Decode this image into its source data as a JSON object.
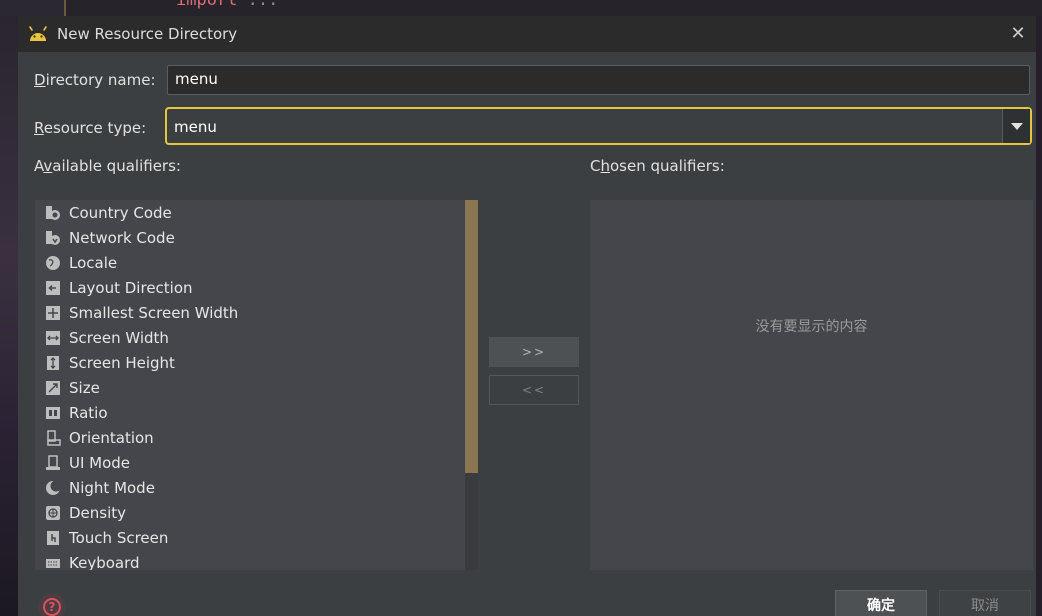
{
  "background": {
    "code_snippet": "import",
    "code_dots": "..."
  },
  "dialog": {
    "title": "New Resource Directory",
    "close_symbol": "✕",
    "directory_name": {
      "label_prefix": "",
      "label_mnemonic": "D",
      "label_rest": "irectory name:",
      "value": "menu"
    },
    "resource_type": {
      "label_mnemonic": "R",
      "label_rest": "esource type:",
      "value": "menu"
    },
    "available_qualifiers": {
      "label_prefix": "A",
      "label_mnemonic": "v",
      "label_rest": "ailable qualifiers:",
      "items": [
        {
          "label": "Country Code",
          "icon": "country-code-icon"
        },
        {
          "label": "Network Code",
          "icon": "network-code-icon"
        },
        {
          "label": "Locale",
          "icon": "globe-icon"
        },
        {
          "label": "Layout Direction",
          "icon": "layout-direction-icon"
        },
        {
          "label": "Smallest Screen Width",
          "icon": "smallest-width-icon"
        },
        {
          "label": "Screen Width",
          "icon": "screen-width-icon"
        },
        {
          "label": "Screen Height",
          "icon": "screen-height-icon"
        },
        {
          "label": "Size",
          "icon": "size-icon"
        },
        {
          "label": "Ratio",
          "icon": "ratio-icon"
        },
        {
          "label": "Orientation",
          "icon": "orientation-icon"
        },
        {
          "label": "UI Mode",
          "icon": "ui-mode-icon"
        },
        {
          "label": "Night Mode",
          "icon": "night-mode-icon"
        },
        {
          "label": "Density",
          "icon": "density-icon"
        },
        {
          "label": "Touch Screen",
          "icon": "touch-screen-icon"
        },
        {
          "label": "Keyboard",
          "icon": "keyboard-icon"
        }
      ]
    },
    "chosen_qualifiers": {
      "label_prefix": "C",
      "label_mnemonic": "h",
      "label_rest": "osen qualifiers:",
      "empty_text": "没有要显示的内容"
    },
    "add_button": ">>",
    "remove_button": "<<",
    "ok_button": "确定",
    "cancel_button": "取消",
    "help_symbol": "?",
    "colors": {
      "focus_border": "#e8c53a",
      "scroll_thumb": "#8a7650",
      "help_red": "#e0505a"
    }
  }
}
